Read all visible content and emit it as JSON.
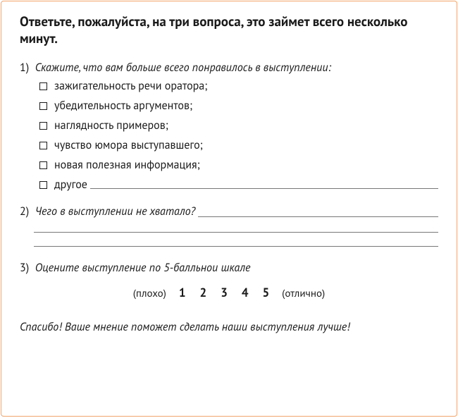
{
  "intro": "Ответьте, пожалуйста, на три вопроса, это займет всего несколько минут.",
  "q1": {
    "num": "1)",
    "text": "Скажите, что вам больше всего понравилось в выступлении:",
    "options": [
      "зажигательность речи оратора;",
      "убедительность аргументов;",
      "наглядность примеров;",
      "чувство юмора выступавшего;",
      "новая полезная информация;",
      "другое"
    ]
  },
  "q2": {
    "num": "2)",
    "text": "Чего в выступлении не хватало?"
  },
  "q3": {
    "num": "3)",
    "text": "Оцените выступление по 5-балльнои шкале",
    "low": "(плохо)",
    "high": "(отлично)",
    "scale": [
      "1",
      "2",
      "3",
      "4",
      "5"
    ]
  },
  "thanks": "Спасибо! Ваше мнение поможет сделать наши выступления лучше!"
}
